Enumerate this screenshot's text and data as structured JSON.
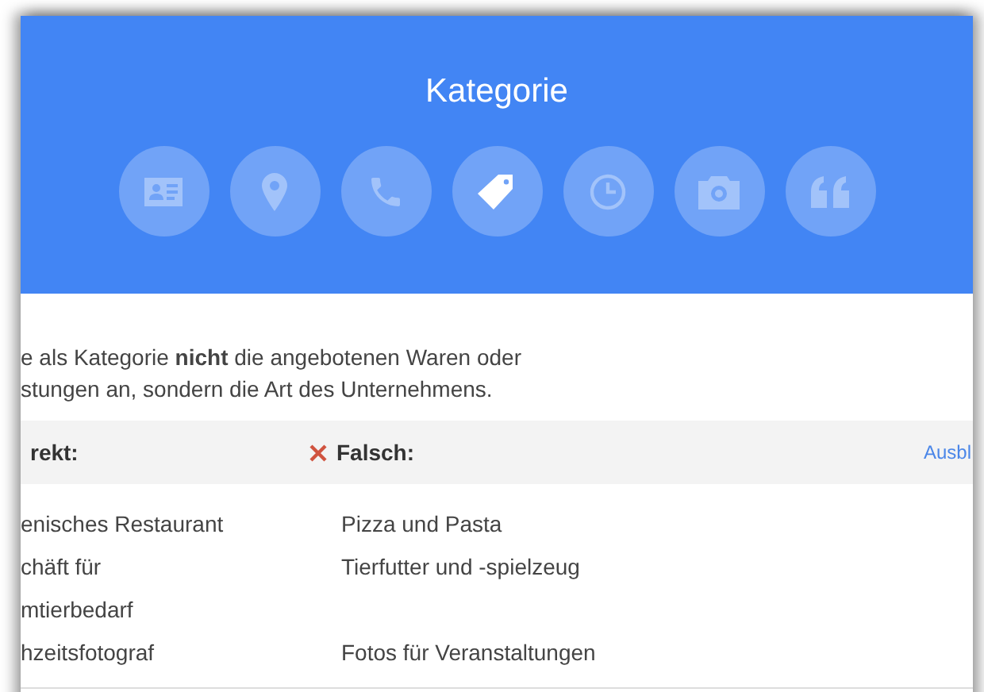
{
  "header": {
    "title": "Kategorie",
    "steps": [
      {
        "kind": "card",
        "selected": false
      },
      {
        "kind": "pin",
        "selected": false
      },
      {
        "kind": "phone",
        "selected": false
      },
      {
        "kind": "tag",
        "selected": true
      },
      {
        "kind": "clock",
        "selected": false
      },
      {
        "kind": "camera",
        "selected": false
      },
      {
        "kind": "quote",
        "selected": false
      }
    ]
  },
  "intro": "e als Kategorie **nicht** die angebotenen Waren oder\nstungen an, sondern die Art des Unternehmens.",
  "table": {
    "columns": [
      {
        "label": "rekt:",
        "kind": "right"
      },
      {
        "label": "Falsch:",
        "kind": "wrong"
      }
    ],
    "hide_link": "Ausbl",
    "rows": [
      [
        "enisches Restaurant",
        "Pizza und Pasta"
      ],
      [
        "chäft für\nmtierbedarf",
        "Tierfutter und -spielzeug"
      ],
      [
        "hzeitsfotograf",
        "Fotos für Veranstaltungen"
      ]
    ]
  }
}
